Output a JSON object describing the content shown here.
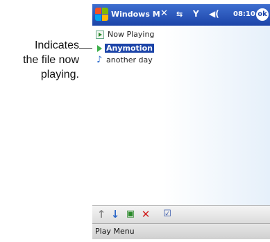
{
  "annotation": {
    "lines": [
      "Indicates",
      "the file now",
      "playing."
    ]
  },
  "titlebar": {
    "title": "Windows M",
    "time": "08:10",
    "ok_label": "ok",
    "icons": [
      "windows-logo",
      "connectivity-icon",
      "sync-icon",
      "signal-icon",
      "volume-icon"
    ]
  },
  "playlist": {
    "header": "Now Playing",
    "items": [
      {
        "label": "Anymotion",
        "selected": true,
        "icon": "now-playing-arrow"
      },
      {
        "label": "another day",
        "selected": false,
        "icon": "music-note"
      }
    ]
  },
  "toolbar": {
    "icons": [
      "move-up-icon",
      "move-down-icon",
      "add-icon",
      "delete-icon",
      "properties-icon"
    ]
  },
  "softkeys": {
    "left": "Play",
    "right": "Menu"
  },
  "colors": {
    "titlebar": "#1c44a8",
    "selection": "#1c44a8",
    "now_playing_arrow": "#3cb04a"
  }
}
